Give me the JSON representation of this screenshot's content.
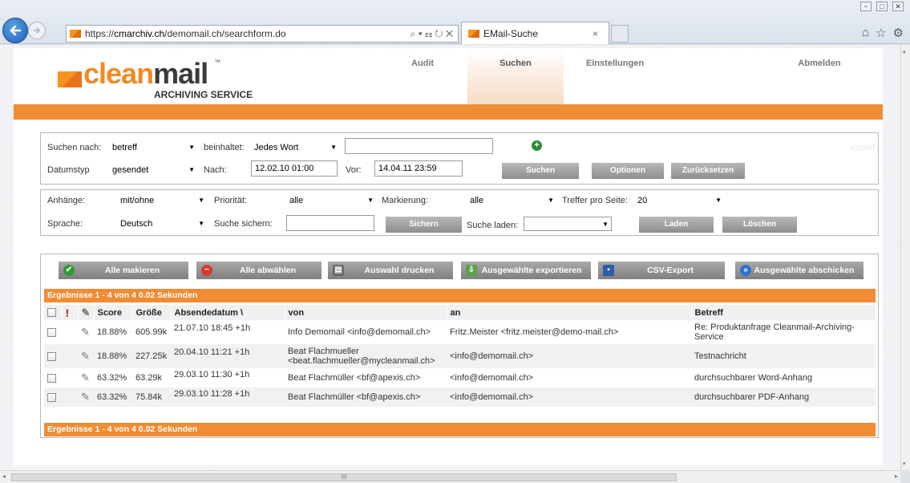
{
  "browser": {
    "url_prefix": "https://",
    "url_host": "cmarchiv.ch",
    "url_path": "/demomail.ch/searchform.do",
    "addr_tools": "⌕ ▾ ☷ ↻ ✕",
    "tab_title": "EMail-Suche",
    "tab_close": "×",
    "win_min": "−",
    "win_max": "□",
    "win_close": "✕",
    "icons": [
      "home-icon",
      "star-icon",
      "gear-icon"
    ]
  },
  "app": {
    "logo_clean": "clean",
    "logo_mail": "mail",
    "logo_tm": "™",
    "logo_sub": "ARCHIVING SERVICE",
    "nav": [
      {
        "label": "Audit",
        "active": false
      },
      {
        "label": "Suchen",
        "active": true
      },
      {
        "label": "Einstellungen",
        "active": false
      },
      {
        "label": "Abmelden",
        "active": false
      }
    ]
  },
  "search": {
    "suchen_nach_label": "Suchen nach:",
    "suchen_nach_value": "betreff",
    "beinhaltet_label": "beinhaltet:",
    "beinhaltet_value": "Jedes Wort",
    "query_value": "",
    "expert_label": "expert",
    "datumstyp_label": "Datumstyp",
    "datumstyp_value": "gesendet",
    "nach_label": "Nach:",
    "nach_value": "12.02.10 01:00",
    "vor_label": "Vor:",
    "vor_value": "14.04.11 23:59",
    "suchen_btn": "Suchen",
    "optionen_btn": "Optionen",
    "reset_btn": "Zurücksetzen",
    "anhaenge_label": "Anhänge:",
    "anhaenge_value": "mit/ohne",
    "prioritaet_label": "Priorität:",
    "prioritaet_value": "alle",
    "markierung_label": "Markierung:",
    "markierung_value": "alle",
    "treffer_label": "Treffer pro Seite:",
    "treffer_value": "20",
    "sprache_label": "Sprache:",
    "sprache_value": "Deutsch",
    "sichern_label": "Suche sichern:",
    "sichern_value": "",
    "sichern_btn": "Sichern",
    "laden_label": "Suche laden:",
    "laden_value": "",
    "laden_btn": "Laden",
    "loeschen_btn": "Löschen"
  },
  "toolbar": {
    "mark_all": "Alle makieren",
    "unmark_all": "Alle abwählen",
    "print": "Auswahl drucken",
    "export": "Ausgewählte exportieren",
    "csv": "CSV-Export",
    "send": "Ausgewählte abschicken"
  },
  "results": {
    "summary": "Ergebnisse  1  - 4 von 4 0.02 Sekunden",
    "columns": {
      "priority": "!",
      "score": "Score",
      "size": "Größe",
      "date": "Absendedatum \\",
      "from": "von",
      "to": "an",
      "subject": "Betreff"
    },
    "rows": [
      {
        "score": "18.88%",
        "size": "605.99k",
        "date": "21.07.10 18:45 +1h",
        "from": "Info Demomail <info@demomail.ch>",
        "to": "Fritz.Meister <fritz.meister@demo-mail.ch>",
        "subject": "Re: Produktanfrage Cleanmail-Archiving-Service"
      },
      {
        "score": "18.88%",
        "size": "227.25k",
        "date": "20.04.10 11:21 +1h",
        "from": "Beat Flachmueller <beat.flachmueller@mycleanmail.ch>",
        "to": "<info@demomail.ch>",
        "subject": "Testnachricht"
      },
      {
        "score": "63.32%",
        "size": "63.29k",
        "date": "29.03.10 11:30 +1h",
        "from": "Beat Flachmüller <bf@apexis.ch>",
        "to": "<info@demomail.ch>",
        "subject": "durchsuchbarer Word-Anhang"
      },
      {
        "score": "63.32%",
        "size": "75.84k",
        "date": "29.03.10 11:28 +1h",
        "from": "Beat Flachmüller <bf@apexis.ch>",
        "to": "<info@demomail.ch>",
        "subject": "durchsuchbarer PDF-Anhang"
      }
    ]
  },
  "scroll": {
    "h_thumb": "III",
    "left": "◂",
    "right": "▸",
    "up": "▴",
    "down": "▾"
  },
  "colors": {
    "accent": "#f08c34",
    "brand_orange": "#f08a24",
    "button_grey": "#8e8e8e"
  }
}
